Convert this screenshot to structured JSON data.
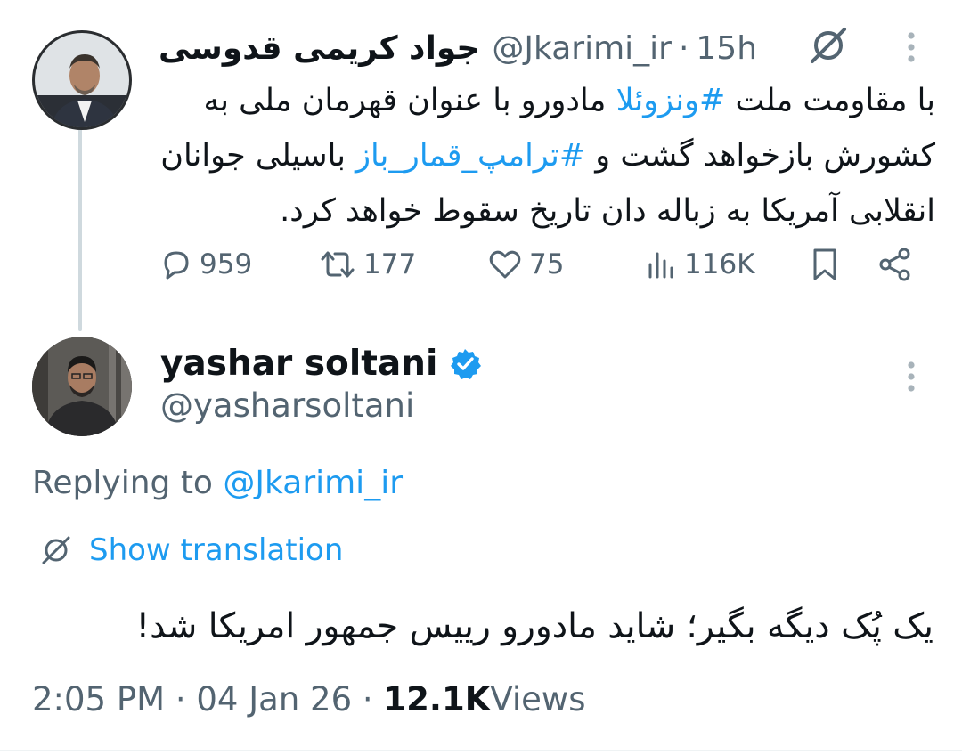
{
  "parent_tweet": {
    "name": "جواد کریمی قدوسی",
    "handle": "@Jkarimi_ir",
    "separator": "·",
    "time": "15h",
    "text_segments": [
      {
        "text": "با مقاومت ملت ",
        "type": "text"
      },
      {
        "text": "#ونزوئلا",
        "type": "hashtag"
      },
      {
        "text": " مادورو با عنوان قهرمان ملی به کشورش بازخواهد گشت و ",
        "type": "text"
      },
      {
        "text": "#ترامپ_قمار_باز",
        "type": "hashtag"
      },
      {
        "text": " باسیلی جوانان انقلابی آمریکا به زباله دان تاریخ سقوط خواهد کرد.",
        "type": "text"
      }
    ],
    "stats": {
      "replies": "959",
      "reposts": "177",
      "likes": "75",
      "views": "116K"
    }
  },
  "reply_tweet": {
    "name": "yashar soltani",
    "handle": "@yasharsoltani",
    "replying_prefix": "Replying to",
    "replying_to": "@Jkarimi_ir",
    "translate_label": "Show translation",
    "text": "یک پُک دیگه بگیر؛ شاید مادورو رییس جمهور امریکا شد!",
    "time": "2:05 PM",
    "sep1": "·",
    "date": "04 Jan 26",
    "sep2": "·",
    "views_count": "12.1K",
    "views_label": "Views"
  },
  "colors": {
    "accent": "#1d9bf0",
    "secondary_text": "#536471",
    "primary_text": "#0f1419",
    "thread_line": "#cfd9de"
  },
  "icons": [
    "grok-icon",
    "more-icon",
    "reply-icon",
    "repost-icon",
    "like-icon",
    "views-icon",
    "bookmark-icon",
    "share-icon",
    "verified-badge-icon",
    "translate-icon"
  ]
}
